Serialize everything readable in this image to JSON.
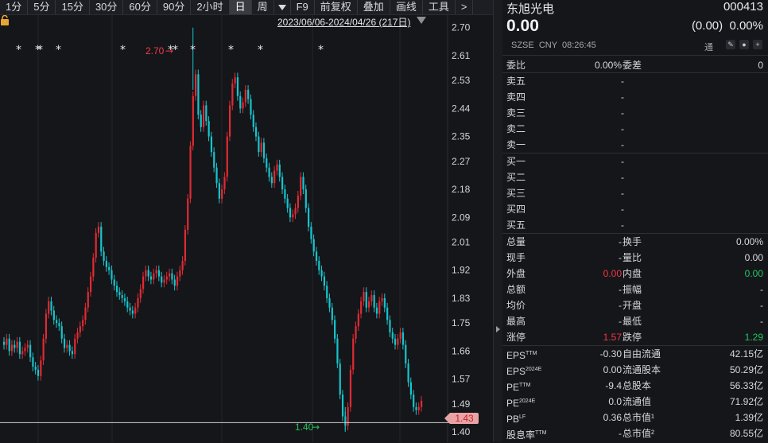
{
  "toolbar": {
    "items": [
      "1分",
      "5分",
      "15分",
      "30分",
      "60分",
      "90分",
      "2小时",
      "日",
      "周",
      "",
      "F9",
      "前复权",
      "叠加",
      "画线",
      "工具",
      ">"
    ],
    "active_index": 7
  },
  "chart": {
    "range_label": "2023/06/06-2024/04/26 (217日)",
    "y_ticks": [
      "2.70",
      "2.61",
      "2.53",
      "2.44",
      "2.35",
      "2.27",
      "2.18",
      "2.09",
      "2.01",
      "1.92",
      "1.83",
      "1.75",
      "1.66",
      "1.57",
      "1.49",
      "1.40"
    ],
    "high_label": "2.70",
    "low_label": "1.40",
    "last_price_label": "1.43",
    "colors": {
      "up": "#e02b34",
      "down": "#16c5cc",
      "bg": "#15161a",
      "grid": "#2a2b30"
    }
  },
  "chart_data": {
    "type": "candlestick",
    "title": "",
    "ylim": [
      1.39,
      2.73
    ],
    "last_price": 1.43,
    "markers": "*",
    "series": [
      {
        "values": [
          1.68,
          1.7,
          1.66,
          1.68,
          1.67,
          1.69,
          1.65,
          1.66,
          1.67,
          1.68,
          1.64,
          1.61,
          1.6,
          1.58,
          1.63,
          1.7,
          1.78,
          1.82,
          1.79,
          1.76,
          1.75,
          1.74,
          1.7,
          1.67,
          1.68,
          1.66,
          1.65,
          1.7,
          1.72,
          1.74,
          1.76,
          1.8,
          1.85,
          1.9,
          1.96,
          2.04,
          2.06,
          1.98,
          1.95,
          1.93,
          1.92,
          1.89,
          1.87,
          1.85,
          1.84,
          1.83,
          1.82,
          1.8,
          1.79,
          1.78,
          1.8,
          1.83,
          1.86,
          1.9,
          1.92,
          1.9,
          1.89,
          1.91,
          1.92,
          1.9,
          1.88,
          1.89,
          1.9,
          1.91,
          1.89,
          1.87,
          1.9,
          1.92,
          1.95,
          2.05,
          2.15,
          2.32,
          2.48,
          2.55,
          2.42,
          2.38,
          2.45,
          2.4,
          2.35,
          2.3,
          2.25,
          2.2,
          2.15,
          2.18,
          2.22,
          2.35,
          2.45,
          2.52,
          2.54,
          2.48,
          2.44,
          2.46,
          2.5,
          2.47,
          2.42,
          2.38,
          2.35,
          2.3,
          2.33,
          2.28,
          2.25,
          2.22,
          2.2,
          2.24,
          2.26,
          2.22,
          2.18,
          2.15,
          2.12,
          2.09,
          2.1,
          2.12,
          2.16,
          2.22,
          2.18,
          2.12,
          2.06,
          2.02,
          1.98,
          1.95,
          1.92,
          1.9,
          1.87,
          1.83,
          1.8,
          1.76,
          1.7,
          1.62,
          1.52,
          1.45,
          1.42,
          1.48,
          1.6,
          1.7,
          1.74,
          1.78,
          1.82,
          1.85,
          1.8,
          1.82,
          1.84,
          1.8,
          1.78,
          1.82,
          1.83,
          1.8,
          1.76,
          1.72,
          1.7,
          1.68,
          1.7,
          1.72,
          1.68,
          1.62,
          1.56,
          1.52,
          1.48,
          1.47,
          1.48,
          1.5
        ]
      }
    ]
  },
  "panel": {
    "name": "东旭光电",
    "code": "000413",
    "price": "0.00",
    "change": "(0.00)  0.00%",
    "meta": "SZSE  CNY  08:26:45",
    "tong": "通",
    "weibi": {
      "l1": "委比",
      "v1": "0.00%",
      "l2": "委差",
      "v2": "0"
    },
    "sell": [
      {
        "label": "卖五",
        "value": "-"
      },
      {
        "label": "卖四",
        "value": "-"
      },
      {
        "label": "卖三",
        "value": "-"
      },
      {
        "label": "卖二",
        "value": "-"
      },
      {
        "label": "卖一",
        "value": "-"
      }
    ],
    "buy": [
      {
        "label": "买一",
        "value": "-"
      },
      {
        "label": "买二",
        "value": "-"
      },
      {
        "label": "买三",
        "value": "-"
      },
      {
        "label": "买四",
        "value": "-"
      },
      {
        "label": "买五",
        "value": "-"
      }
    ],
    "stats": [
      {
        "l1": "总量",
        "v1": "-",
        "l2": "换手",
        "v2": "0.00%"
      },
      {
        "l1": "现手",
        "v1": "-",
        "l2": "量比",
        "v2": "0.00"
      },
      {
        "l1": "外盘",
        "v1": "0.00",
        "l2": "内盘",
        "v2": "0.00"
      },
      {
        "l1": "总额",
        "v1": "-",
        "l2": "振幅",
        "v2": "-"
      },
      {
        "l1": "均价",
        "v1": "-",
        "l2": "开盘",
        "v2": "-"
      },
      {
        "l1": "最高",
        "v1": "-",
        "l2": "最低",
        "v2": "-"
      },
      {
        "l1": "涨停",
        "v1": "1.57",
        "l2": "跌停",
        "v2": "1.29"
      }
    ],
    "fund": [
      {
        "l1": "EPS",
        "s1": "TTM",
        "v1": "-0.30",
        "l2": "自由流通",
        "v2": "42.15亿"
      },
      {
        "l1": "EPS",
        "s1": "2024E",
        "v1": "0.00",
        "l2": "流通股本",
        "v2": "50.29亿"
      },
      {
        "l1": "PE",
        "s1": "TTM",
        "v1": "-9.4",
        "l2": "总股本",
        "v2": "56.33亿"
      },
      {
        "l1": "PE",
        "s1": "2024E",
        "v1": "0.0",
        "l2": "流通值",
        "v2": "71.92亿"
      },
      {
        "l1": "PB",
        "s1": "LF",
        "v1": "0.36",
        "l2": "总市值¹",
        "v2": "1.39亿"
      },
      {
        "l1": "股息率",
        "s1": "TTM",
        "v1": "-",
        "l2": "总市值²",
        "v2": "80.55亿"
      }
    ]
  }
}
